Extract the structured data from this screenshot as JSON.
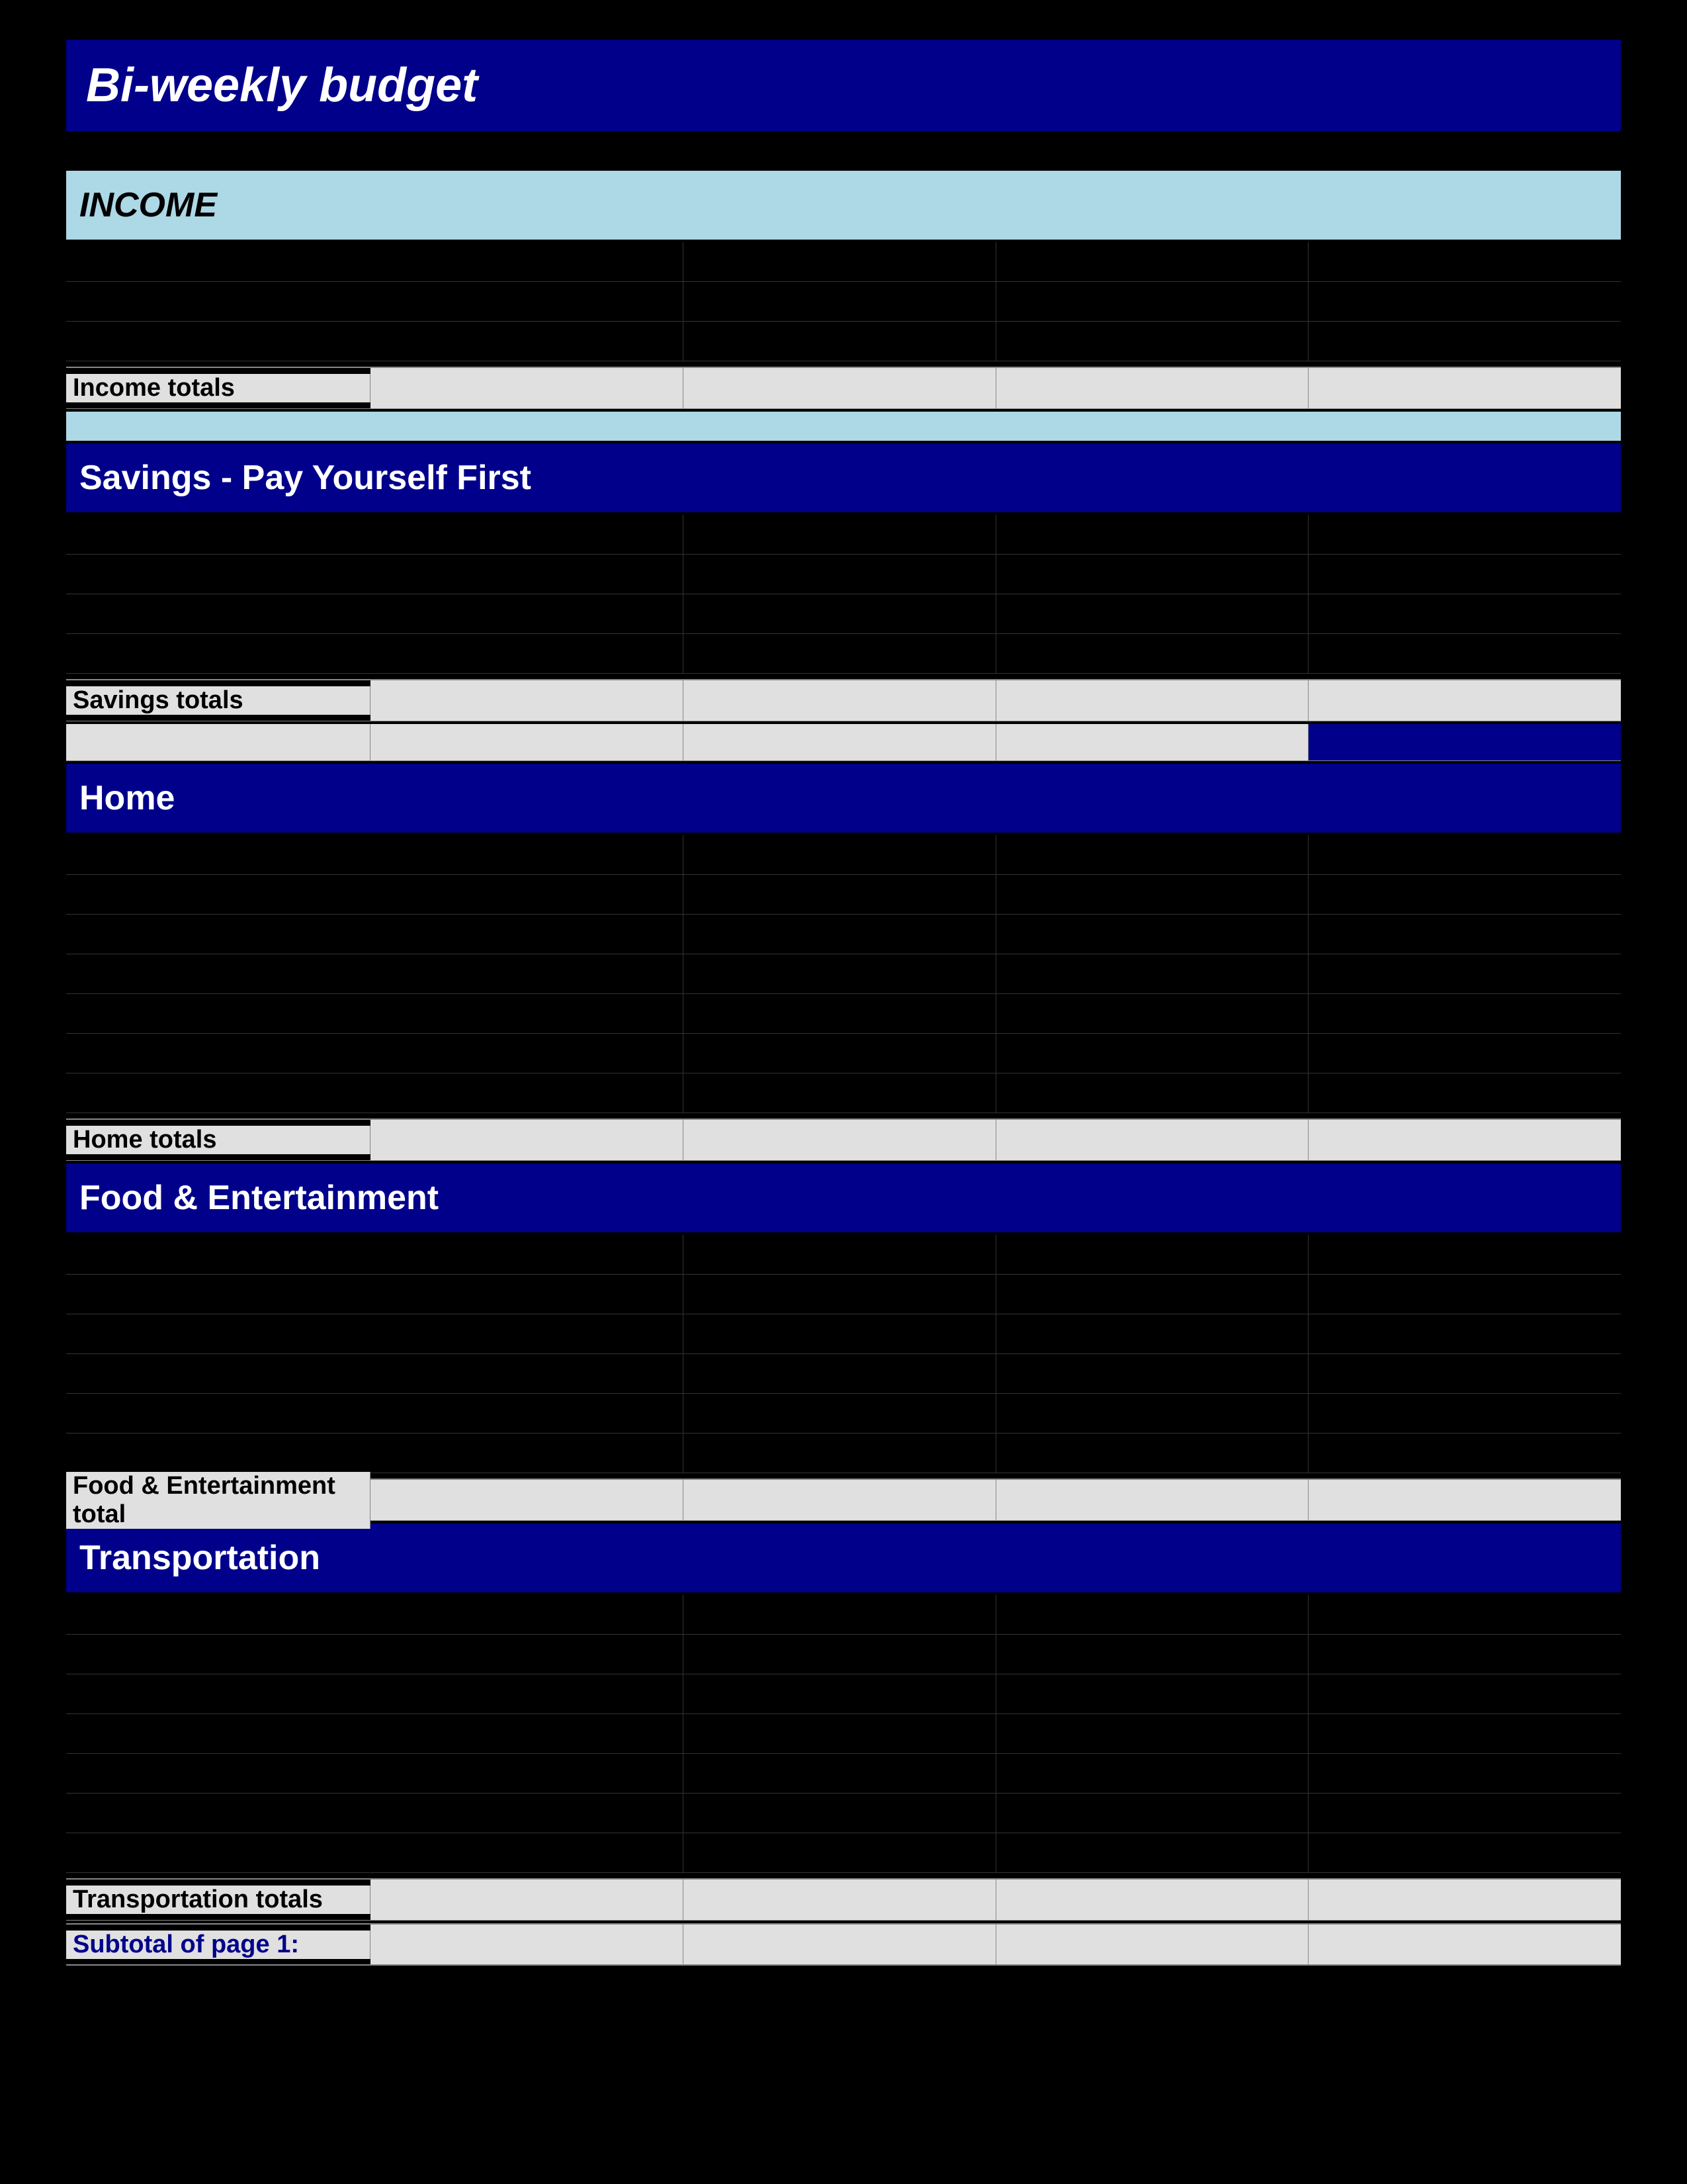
{
  "title": "Bi-weekly  budget",
  "sections": {
    "income": {
      "label": "Income",
      "totals_label": "Income totals"
    },
    "savings": {
      "label": "Savings - Pay Yourself First",
      "totals_label": "Savings totals"
    },
    "home": {
      "label": "Home",
      "totals_label": "Home totals"
    },
    "food": {
      "label": "Food & Entertainment",
      "totals_label": "Food & Entertainment total"
    },
    "transportation": {
      "label": "Transportation",
      "totals_label": "Transportation totals"
    },
    "subtotal": {
      "label": "Subtotal of page 1:"
    }
  },
  "num_data_rows": 5,
  "num_cols": 4
}
